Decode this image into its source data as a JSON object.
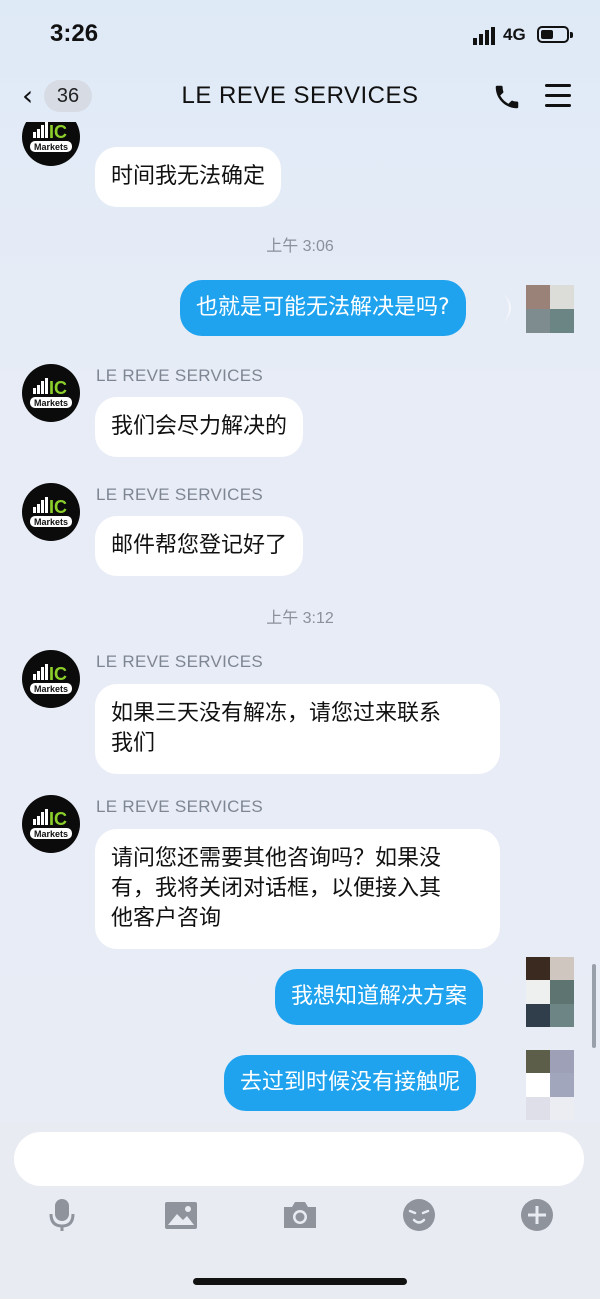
{
  "status": {
    "time": "3:26",
    "network": "4G"
  },
  "nav": {
    "back_count": "36",
    "title": "LE REVE SERVICES"
  },
  "colors": {
    "accent": "#1fa3ee",
    "incoming_bubble": "#ffffff"
  },
  "messages": {
    "m1": {
      "text": "时间我无法确定"
    },
    "ts1": "上午 3:06",
    "m2": {
      "text": "也就是可能无法解决是吗?"
    },
    "m3": {
      "sender": "LE REVE SERVICES",
      "text": "我们会尽力解决的"
    },
    "m4": {
      "sender": "LE REVE SERVICES",
      "text": "邮件帮您登记好了"
    },
    "ts2": "上午 3:12",
    "m5": {
      "sender": "LE REVE SERVICES",
      "line1": "如果三天没有解冻，请您过来联系",
      "line2": "我们"
    },
    "m6": {
      "sender": "LE REVE SERVICES",
      "line1": "请问您还需要其他咨询吗？如果没",
      "line2": "有，我将关闭对话框，以便接入其",
      "line3": "他客户咨询"
    },
    "m7": {
      "text": "我想知道解决方案"
    },
    "m8": {
      "text": "去过到时候没有接触呢"
    }
  },
  "avatar": {
    "logo_text": "IC",
    "logo_sub": "Markets"
  },
  "toolbar": {
    "icons": [
      "microphone-icon",
      "image-icon",
      "camera-icon",
      "emoji-icon",
      "plus-icon"
    ]
  }
}
